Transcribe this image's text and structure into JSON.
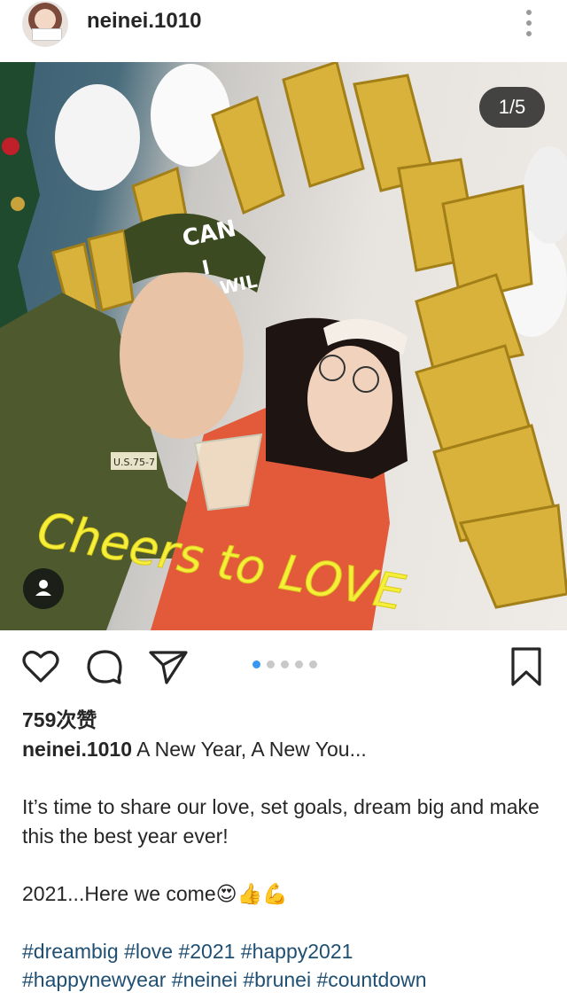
{
  "header": {
    "username": "neinei.1010",
    "avatar_icon": "profile-avatar",
    "more_icon": "more-vertical-icon"
  },
  "photo": {
    "counter": "1/5",
    "overlay_text": "Cheers to LOVE",
    "cap_text_line1": "CAN",
    "cap_text_line2": "I",
    "cap_text_line3": "WIL",
    "badge_text": "U.S.75-7",
    "user_tag_icon": "person-icon"
  },
  "actions": {
    "like_icon": "heart-icon",
    "comment_icon": "comment-icon",
    "share_icon": "send-icon",
    "save_icon": "bookmark-icon",
    "carousel_dots": 5,
    "active_dot": 1
  },
  "likes": "759次赞",
  "caption": {
    "user": "neinei.1010",
    "first_line": " A New Year, A New You...",
    "para1": "It’s time to share our love, set goals, dream big and make this the best year ever!",
    "para2": "2021...Here we come😍👍💪",
    "tags_line1": "#dreambig #love #2021 #happy2021",
    "tags_line2": "#happynewyear #neinei #brunei #countdown"
  },
  "colors": {
    "accent": "#3897f0",
    "hashtag": "#1f4f73",
    "text": "#262626",
    "overlay_yellow": "#f5ef3a"
  }
}
